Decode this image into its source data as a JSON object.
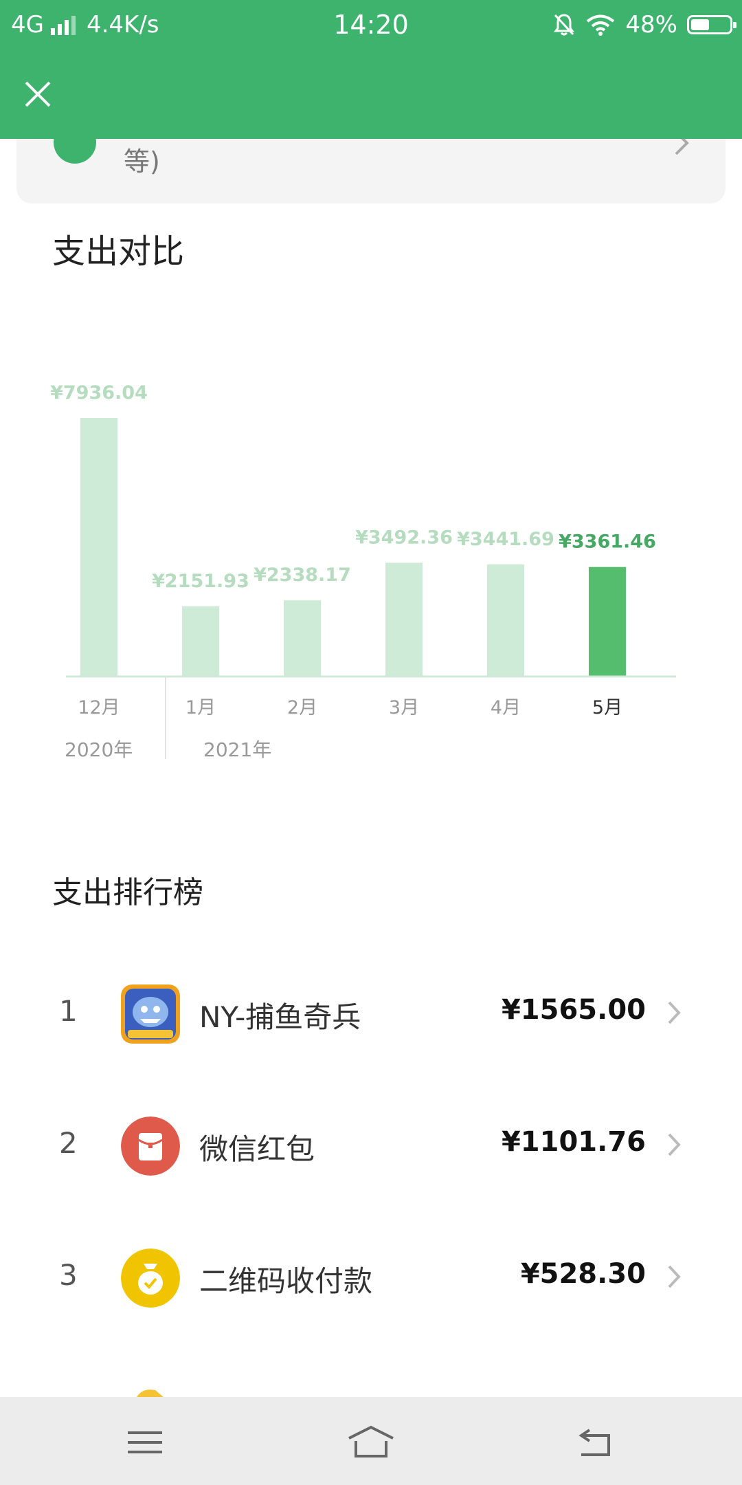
{
  "status_bar": {
    "network": "4G",
    "speed": "4.4K/s",
    "time": "14:20",
    "battery": "48%"
  },
  "card": {
    "partial_text": "等)"
  },
  "compare": {
    "title": "支出对比"
  },
  "chart_data": {
    "type": "bar",
    "categories": [
      "12月",
      "1月",
      "2月",
      "3月",
      "4月",
      "5月"
    ],
    "values": [
      7936.04,
      2151.93,
      2338.17,
      3492.36,
      3441.69,
      3361.46
    ],
    "value_labels": [
      "¥7936.04",
      "¥2151.93",
      "¥2338.17",
      "¥3492.36",
      "¥3441.69",
      "¥3361.46"
    ],
    "highlight_index": 5,
    "year_labels": [
      "2020年",
      "2021年"
    ],
    "colors": {
      "normal": "#cdebd6",
      "highlight": "#55bd6e",
      "label_normal": "#b5dcbf",
      "label_highlight": "#45a863"
    }
  },
  "ranking": {
    "title": "支出排行榜",
    "items": [
      {
        "rank": "1",
        "name": "NY-捕鱼奇兵",
        "amount": "¥1565.00",
        "icon": "game-icon"
      },
      {
        "rank": "2",
        "name": "微信红包",
        "amount": "¥1101.76",
        "icon": "red-packet-icon"
      },
      {
        "rank": "3",
        "name": "二维码收付款",
        "amount": "¥528.30",
        "icon": "qr-money-bag-icon"
      }
    ]
  }
}
